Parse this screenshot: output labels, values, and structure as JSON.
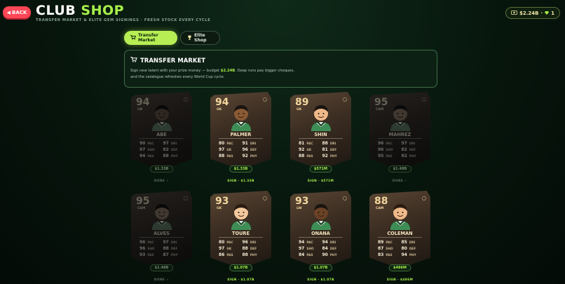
{
  "header": {
    "back_label": "BACK",
    "title_white": "CLUB",
    "title_green": "SHOP",
    "subtitle": "TRANSFER MARKET & ELITE GEM SIGNINGS · FRESH STOCK EVERY CYCLE",
    "balance_money": "$2.24B",
    "balance_gems": "1"
  },
  "tabs": [
    {
      "label": "Transfer Market",
      "icon": "cart-icon"
    },
    {
      "label": "Elite Shop",
      "icon": "gem-icon"
    }
  ],
  "info": {
    "title": "TRANSFER MARKET",
    "line1_pre": "Sign new talent with your prize money — budget ",
    "budget": "$2.24B",
    "line1_post": ". Deep runs pay bigger cheques,",
    "line2": "and the catalogue refreshes every World Cup cycle."
  },
  "players": [
    {
      "rating": "94",
      "pos": "LW",
      "name": "ABE",
      "stats": [
        [
          "90",
          "PAC"
        ],
        [
          "97",
          "DRI"
        ],
        [
          "97",
          "SHO"
        ],
        [
          "82",
          "DEF"
        ],
        [
          "94",
          "PAS"
        ],
        [
          "88",
          "PHY"
        ]
      ],
      "price": "$1.33B",
      "action": "DONE ✓",
      "sold": true,
      "skin": "#7a5136",
      "hair": "#1a1410"
    },
    {
      "rating": "94",
      "pos": "GK",
      "name": "PALMER",
      "stats": [
        [
          "80",
          "PAC"
        ],
        [
          "91",
          "DRI"
        ],
        [
          "97",
          "GK"
        ],
        [
          "96",
          "DEF"
        ],
        [
          "88",
          "PAS"
        ],
        [
          "92",
          "PHY"
        ]
      ],
      "price": "$1.33B",
      "action": "SIGN · $1.33B",
      "sold": false,
      "skin": "#8a5a34",
      "hair": "#1a1410"
    },
    {
      "rating": "89",
      "pos": "GK",
      "name": "SHIN",
      "stats": [
        [
          "81",
          "PAC"
        ],
        [
          "88",
          "DRI"
        ],
        [
          "92",
          "GK"
        ],
        [
          "81",
          "DEF"
        ],
        [
          "88",
          "PAS"
        ],
        [
          "92",
          "PHY"
        ]
      ],
      "price": "$571M",
      "action": "SIGN · $571M",
      "sold": false,
      "skin": "#f0b98a",
      "hair": "#1a1410"
    },
    {
      "rating": "95",
      "pos": "CAM",
      "name": "MAHREZ",
      "stats": [
        [
          "96",
          "PAC"
        ],
        [
          "97",
          "DRI"
        ],
        [
          "96",
          "SHO"
        ],
        [
          "82",
          "DEF"
        ],
        [
          "95",
          "PAS"
        ],
        [
          "82",
          "PHY"
        ]
      ],
      "price": "$1.48B",
      "action": "DONE ✓",
      "sold": true,
      "skin": "#a8764a",
      "hair": "#1a1410"
    },
    {
      "rating": "95",
      "pos": "CAM",
      "name": "ALVES",
      "stats": [
        [
          "96",
          "PAC"
        ],
        [
          "97",
          "DRI"
        ],
        [
          "96",
          "SHO"
        ],
        [
          "88",
          "DEF"
        ],
        [
          "93",
          "PAS"
        ],
        [
          "87",
          "PHY"
        ]
      ],
      "price": "$1.48B",
      "action": "DONE ✓",
      "sold": true,
      "skin": "#a8764a",
      "hair": "#1a1410"
    },
    {
      "rating": "93",
      "pos": "GK",
      "name": "TOURE",
      "stats": [
        [
          "80",
          "PAC"
        ],
        [
          "96",
          "DRI"
        ],
        [
          "97",
          "GK"
        ],
        [
          "88",
          "DEF"
        ],
        [
          "86",
          "PAS"
        ],
        [
          "88",
          "PHY"
        ]
      ],
      "price": "$1.07B",
      "action": "SIGN · $1.07B",
      "sold": false,
      "skin": "#f3c89c",
      "hair": "#2a1c12"
    },
    {
      "rating": "93",
      "pos": "LW",
      "name": "ONANA",
      "stats": [
        [
          "94",
          "PAC"
        ],
        [
          "94",
          "DRI"
        ],
        [
          "97",
          "SHO"
        ],
        [
          "84",
          "DEF"
        ],
        [
          "84",
          "PAS"
        ],
        [
          "90",
          "PHY"
        ]
      ],
      "price": "$1.07B",
      "action": "SIGN · $1.07B",
      "sold": false,
      "skin": "#6b4226",
      "hair": "#1a1410"
    },
    {
      "rating": "88",
      "pos": "CAM",
      "name": "COLEMAN",
      "stats": [
        [
          "89",
          "PAC"
        ],
        [
          "85",
          "DRI"
        ],
        [
          "87",
          "SHO"
        ],
        [
          "80",
          "DEF"
        ],
        [
          "83",
          "PAS"
        ],
        [
          "94",
          "PHY"
        ]
      ],
      "price": "$486M",
      "action": "SIGN · $486M",
      "sold": false,
      "skin": "#f0b98a",
      "hair": "#2a1c12"
    }
  ]
}
